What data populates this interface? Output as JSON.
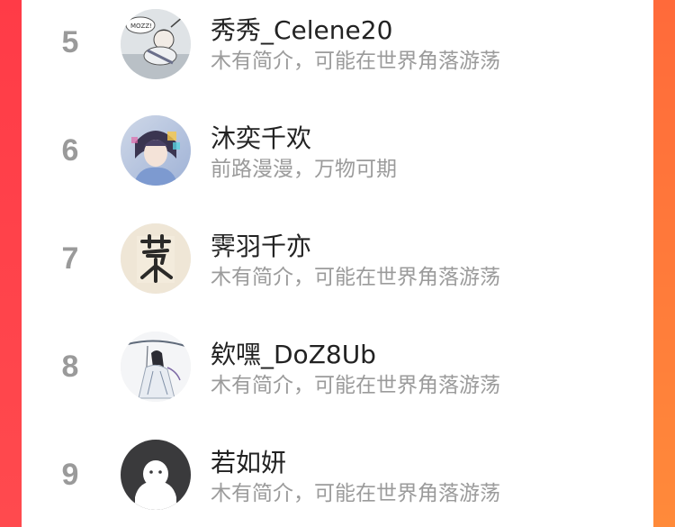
{
  "colors": {
    "left_edge": "#ff3b47",
    "right_edge": "#ff7a3a",
    "rank_text": "#9a9a9a",
    "name_text": "#222222",
    "bio_text": "#9b9b9b"
  },
  "ranking": [
    {
      "rank": "5",
      "name": "秀秀_Celene20",
      "bio": "木有简介，可能在世界角落游荡",
      "avatar": "anime-art-avatar"
    },
    {
      "rank": "6",
      "name": "沐奕千欢",
      "bio": "前路漫漫，万物可期",
      "avatar": "anime-boy-avatar"
    },
    {
      "rank": "7",
      "name": "霁羽千亦",
      "bio": "木有简介，可能在世界角落游荡",
      "avatar": "calligraphy-avatar"
    },
    {
      "rank": "8",
      "name": "欸嘿_DoZ8Ub",
      "bio": "木有简介，可能在世界角落游荡",
      "avatar": "ink-figure-avatar"
    },
    {
      "rank": "9",
      "name": "若如妍",
      "bio": "木有简介，可能在世界角落游荡",
      "avatar": "default-ghost-avatar"
    }
  ]
}
